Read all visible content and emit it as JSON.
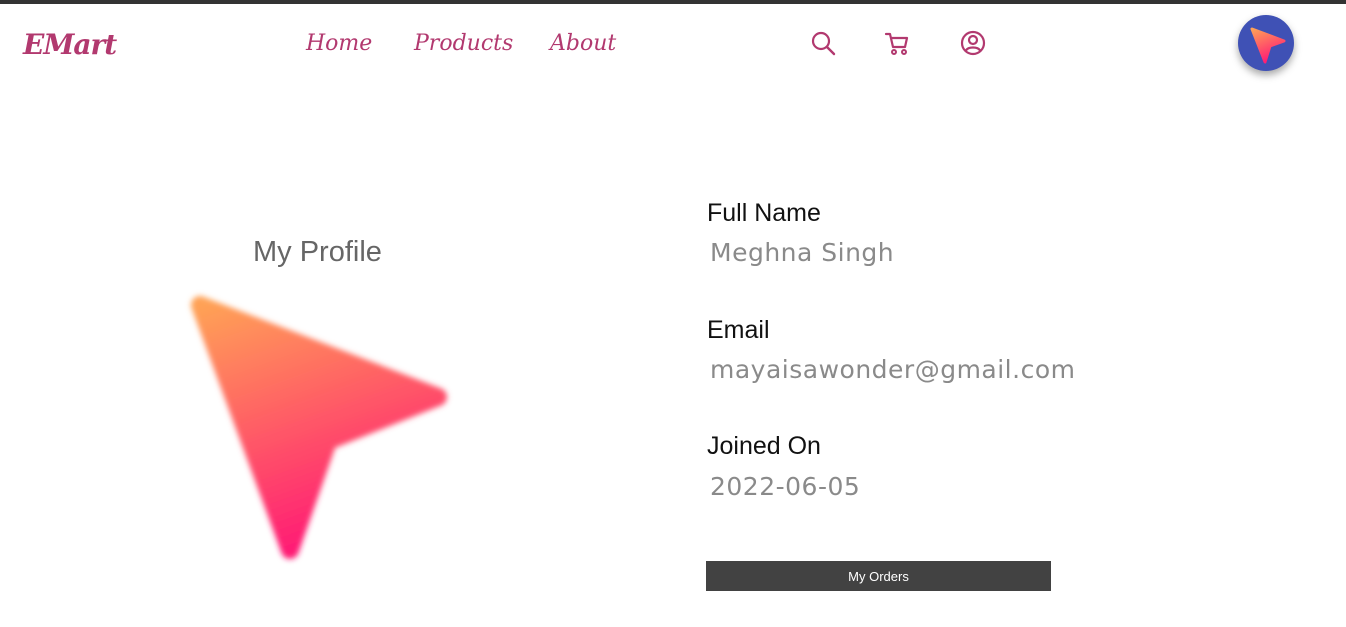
{
  "brand": {
    "name": "EMart"
  },
  "nav": {
    "links": [
      {
        "label": "Home"
      },
      {
        "label": "Products"
      },
      {
        "label": "About"
      }
    ],
    "icons": [
      "search-icon",
      "cart-icon",
      "account-icon"
    ]
  },
  "colors": {
    "brand": "#b2396f",
    "fab": "#3f51b5",
    "button": "#424242",
    "gradient_start": "#ffa256",
    "gradient_end": "#ff1e74"
  },
  "profile": {
    "title": "My Profile",
    "fields": [
      {
        "label": "Full Name",
        "value": "Meghna Singh"
      },
      {
        "label": "Email",
        "value": "mayaisawonder@gmail.com"
      },
      {
        "label": "Joined On",
        "value": "2022-06-05"
      }
    ],
    "orders_button": "My Orders"
  }
}
